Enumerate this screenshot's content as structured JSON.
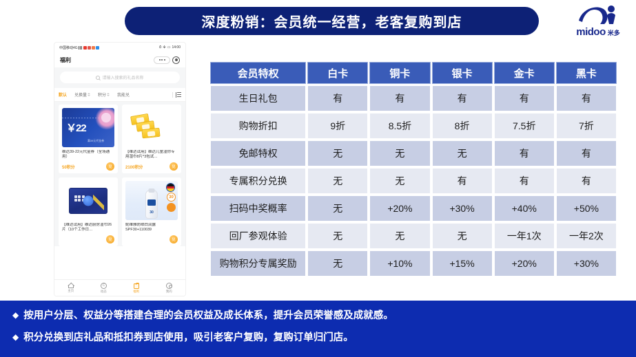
{
  "slide": {
    "title": "深度粉销：会员统一经营，老客复购到店",
    "colors": {
      "title_banner": "#0d2176",
      "bottom_band": "#0d2cb0",
      "table_header": "#3a5cb8",
      "row_odd": "#c7cee4",
      "row_even": "#e6e9f2",
      "accent_orange": "#f5a623",
      "logo_blue": "#18288c"
    }
  },
  "logo": {
    "name_en": "midoo",
    "name_cn": "米多"
  },
  "phone": {
    "statusbar": {
      "carrier": "中国移动4G",
      "time": "14:00"
    },
    "app_title": "福利",
    "search_placeholder": "请输入搜索的礼品名称",
    "tabs": [
      {
        "label": "默认",
        "active": true,
        "sortable": false
      },
      {
        "label": "兑换量",
        "active": false,
        "sortable": true
      },
      {
        "label": "积分",
        "active": false,
        "sortable": true
      },
      {
        "label": "我能兑",
        "active": false,
        "sortable": false
      }
    ],
    "cards": [
      {
        "title": "维达39-22元代金券（全场通用）",
        "points": "50积分",
        "button": "兑",
        "art": "coupon",
        "coupon_amount": "￥22",
        "coupon_sub": "满39元代金券"
      },
      {
        "title": "【维达试用】维达儿童湿你专用湿巾8片*3包试…",
        "points": "2100积分",
        "button": "兑",
        "art": "packs"
      },
      {
        "title": "【维达试用】维达厨房湿巾26片（10个工作日…",
        "points": "",
        "button": "兑",
        "art": "kitchen"
      },
      {
        "title": "妮维雅防晒白润露SPF30+110039",
        "points": "",
        "button": "兑",
        "art": "nivea",
        "spf": "30"
      }
    ],
    "bottom_nav": [
      {
        "label": "主页",
        "icon": "home-icon",
        "active": false
      },
      {
        "label": "动态",
        "icon": "compass-icon",
        "active": false
      },
      {
        "label": "福利",
        "icon": "gift-icon",
        "active": true
      },
      {
        "label": "我的",
        "icon": "user-icon",
        "active": false
      }
    ]
  },
  "table": {
    "headers": [
      "会员特权",
      "白卡",
      "铜卡",
      "银卡",
      "金卡",
      "黑卡"
    ],
    "rows": [
      {
        "feature": "生日礼包",
        "values": [
          "有",
          "有",
          "有",
          "有",
          "有"
        ]
      },
      {
        "feature": "购物折扣",
        "values": [
          "9折",
          "8.5折",
          "8折",
          "7.5折",
          "7折"
        ]
      },
      {
        "feature": "免邮特权",
        "values": [
          "无",
          "无",
          "无",
          "有",
          "有"
        ]
      },
      {
        "feature": "专属积分兑换",
        "values": [
          "无",
          "无",
          "有",
          "有",
          "有"
        ]
      },
      {
        "feature": "扫码中奖概率",
        "values": [
          "无",
          "+20%",
          "+30%",
          "+40%",
          "+50%"
        ]
      },
      {
        "feature": "回厂参观体验",
        "values": [
          "无",
          "无",
          "无",
          "一年1次",
          "一年2次"
        ]
      },
      {
        "feature": "购物积分专属奖励",
        "values": [
          "无",
          "+10%",
          "+15%",
          "+20%",
          "+30%"
        ]
      }
    ]
  },
  "bullets": [
    {
      "marker": "◆",
      "text": "按用户分层、权益分等搭建合理的会员权益及成长体系，提升会员荣誉感及成就感。"
    },
    {
      "marker": "◆",
      "text": "积分兑换到店礼品和抵扣券到店使用，吸引老客户复购，复购订单归门店。"
    }
  ]
}
